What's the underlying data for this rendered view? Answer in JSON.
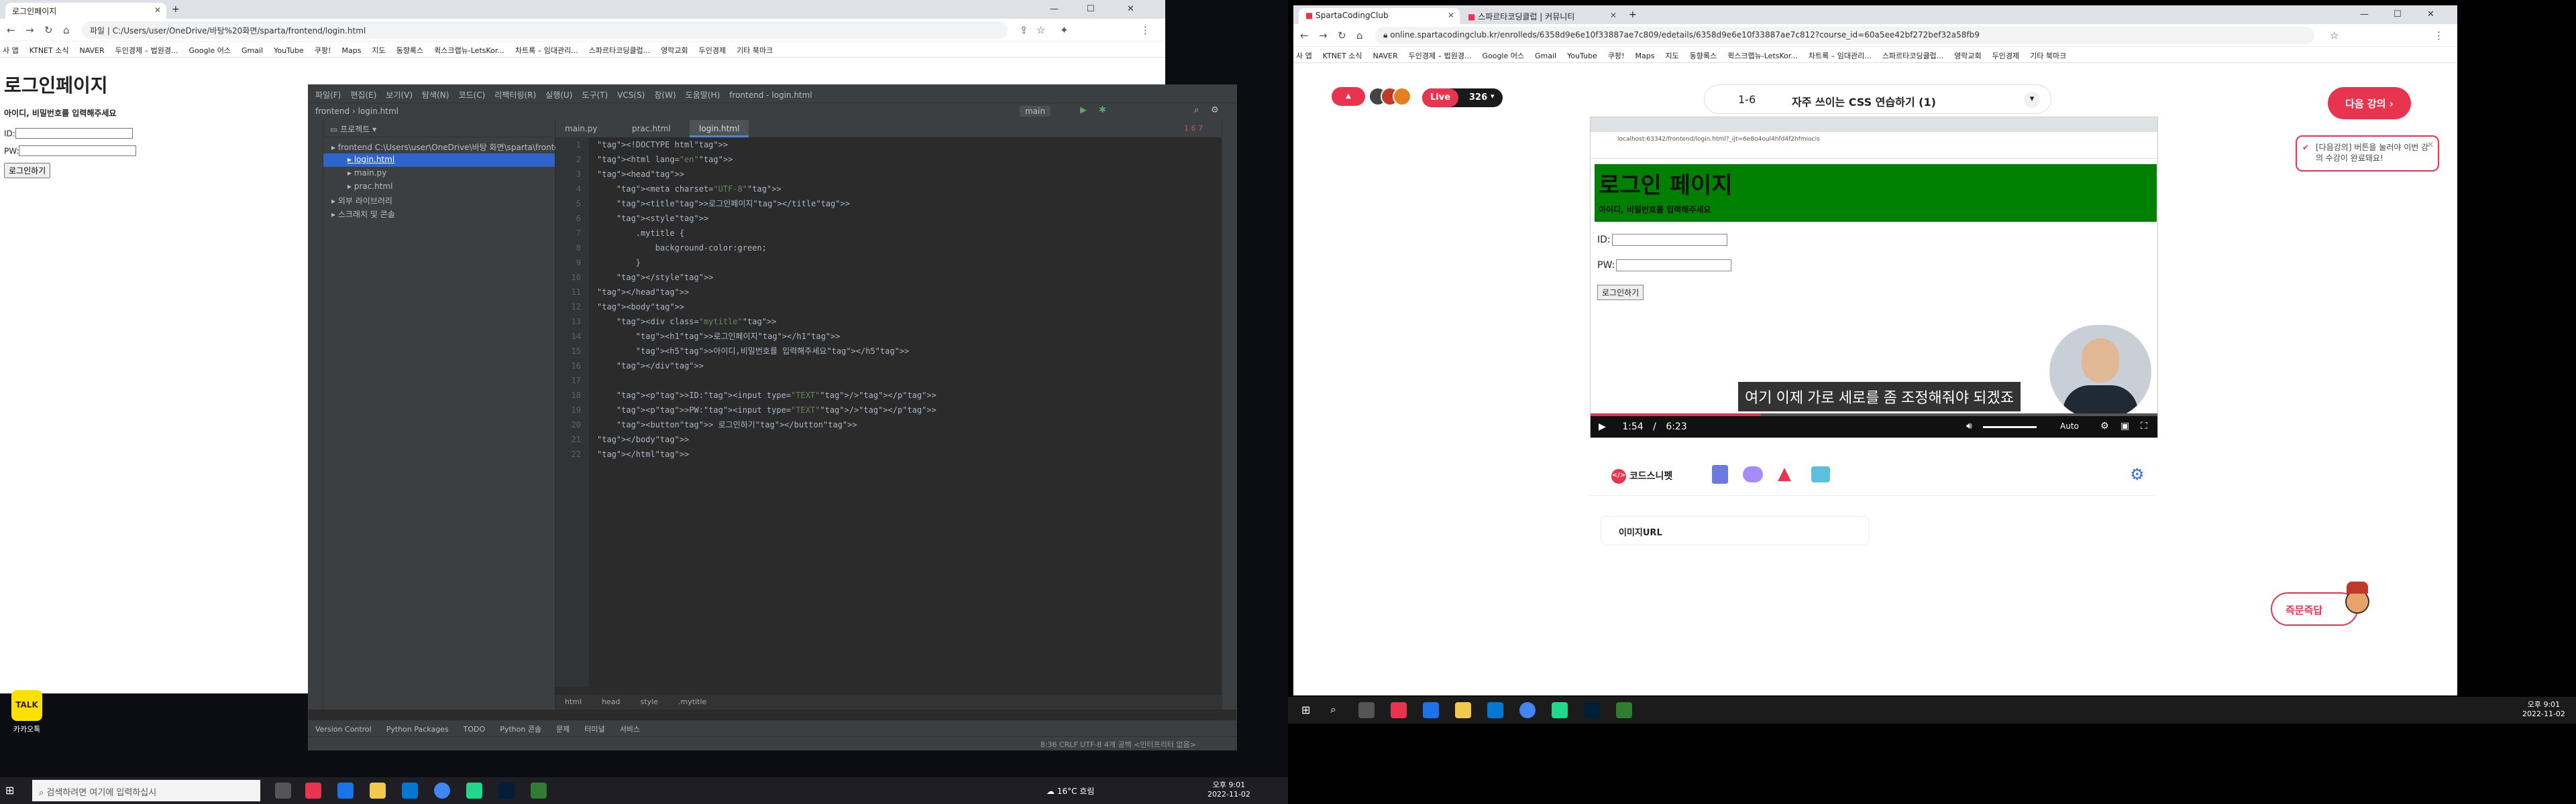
{
  "left_browser": {
    "tab_title": "로그인페이지",
    "address": "파일 | C:/Users/user/OneDrive/바탕%20화면/sparta/frontend/login.html",
    "bookmarks": [
      "사 앱",
      "KTNET 소식",
      "NAVER",
      "두인경제 – 법원경...",
      "Google 어스",
      "Gmail",
      "YouTube",
      "쿠팡!",
      "Maps",
      "지도",
      "동향록스",
      "퀵스크랩뉴-LetsKor...",
      "차트록 – 임대관리...",
      "스파르타코딩클럽...",
      "영락교회",
      "두인경제",
      "기타 북마크"
    ],
    "page": {
      "h1": "로그인페이지",
      "h5": "아이디, 비밀번호를 입력해주세요",
      "id_label": "ID:",
      "pw_label": "PW:",
      "button": "로그인하기"
    }
  },
  "kakao": {
    "icon_text": "TALK",
    "label": "카카오톡"
  },
  "ide": {
    "menu": [
      "파일(F)",
      "편집(E)",
      "보기(V)",
      "탐색(N)",
      "코드(C)",
      "리팩터링(R)",
      "실행(U)",
      "도구(T)",
      "VCS(S)",
      "창(W)",
      "도움말(H)",
      "frontend - login.html"
    ],
    "nav": [
      "frontend",
      "login.html"
    ],
    "run_config": "main",
    "project_header": "프로젝트",
    "tree": [
      {
        "label": "frontend  C:\\Users\\user\\OneDrive\\바탕 화면\\sparta\\frontend",
        "indent": 1,
        "selected": false
      },
      {
        "label": "login.html",
        "indent": 3,
        "selected": true
      },
      {
        "label": "main.py",
        "indent": 3,
        "selected": false
      },
      {
        "label": "prac.html",
        "indent": 3,
        "selected": false
      },
      {
        "label": "외부 라이브러리",
        "indent": 1,
        "selected": false
      },
      {
        "label": "스크래치 및 콘솔",
        "indent": 1,
        "selected": false
      }
    ],
    "editor_tabs": [
      "main.py",
      "prac.html",
      "login.html"
    ],
    "inspection": "1  6  7",
    "code_lines": [
      "<!DOCTYPE html>",
      "<html lang=\"en\">",
      "<head>",
      "    <meta charset=\"UTF-8\">",
      "    <title>로그인페이지</title>",
      "    <style>",
      "        .mytitle {",
      "            background-color:green;",
      "        }",
      "    </style>",
      "</head>",
      "<body>",
      "    <div class=\"mytitle\">",
      "        <h1>로그인페이지</h1>",
      "        <h5>아이디,비밀번호를 입력해주세요</h5>",
      "    </div>",
      "",
      "    <p>ID:<input type=\"TEXT\"/></p>",
      "    <p>PW:<input type=\"TEXT\"/></p>",
      "    <button> 로그인하기</button>",
      "</body>",
      "</html>"
    ],
    "breadcrumb": [
      "html",
      "head",
      "style",
      ".mytitle"
    ],
    "bottom_tools": [
      "Version Control",
      "Python Packages",
      "TODO",
      "Python 콘솔",
      "문제",
      "터미널",
      "서비스"
    ],
    "status_right": "8:36  CRLF  UTF-8  4개 공백  <인터프리터 없음>"
  },
  "taskbar_left": {
    "search_placeholder": "검색하려면 여기에 입력하십시",
    "weather": "16°C 흐림",
    "clock_time": "오후 9:01",
    "clock_date": "2022-11-02"
  },
  "right_browser": {
    "tabs": [
      "SpartaCodingClub",
      "스파르타코딩클럽 | 커뮤니티"
    ],
    "address": "online.spartacodingclub.kr/enrolleds/6358d9e6e10f33887ae7c809/edetails/6358d9e6e10f33887ae7c812?course_id=60a5ee42bf272bef32a58fb9",
    "bookmarks": [
      "사 앱",
      "KTNET 소식",
      "NAVER",
      "두인경제 – 법원경...",
      "Google 어스",
      "Gmail",
      "YouTube",
      "쿠팡!",
      "Maps",
      "지도",
      "동향록스",
      "퀵스크랩뉴-LetsKor...",
      "차트록 – 임대관리...",
      "스파르타코딩클럽...",
      "영락교회",
      "두인경제",
      "기타 북마크"
    ],
    "live_label": "Live",
    "live_count": "326",
    "lesson_no": "1-6",
    "lesson_title": "자주 쓰이는 CSS 연습하기 (1)",
    "next_button": "다음 강의",
    "tooltip": "[다음강의] 버튼을 눌러야 이번 강의 수강이 완료돼요!",
    "video": {
      "inner_address": "localhost:63342/frontend/login.html?_ijt=6e8o4oul4hfd4f2hfmiocis",
      "inner_h1": "로그인 페이지",
      "inner_h5": "아이디, 비밀번호를 입력해주세요",
      "inner_id": "ID:",
      "inner_pw": "PW:",
      "inner_button": "로그인하기",
      "subtitle": "여기 이제 가로 세로를 좀 조정해줘야 되겠죠",
      "current_time": "1:54",
      "duration": "6:23",
      "progress": 0.3,
      "quality": "Auto"
    },
    "snippet_tab": "코드스니펫",
    "snippet_item": "이미지URL",
    "qa_button": "즉문즉답"
  },
  "taskbar_right": {
    "clock_time": "오후 9:01",
    "clock_date": "2022-11-02"
  },
  "colors": {
    "live": "#e8344e",
    "next": "#e8344e",
    "green": "#008000",
    "ide_bg": "#2b2b2b"
  }
}
